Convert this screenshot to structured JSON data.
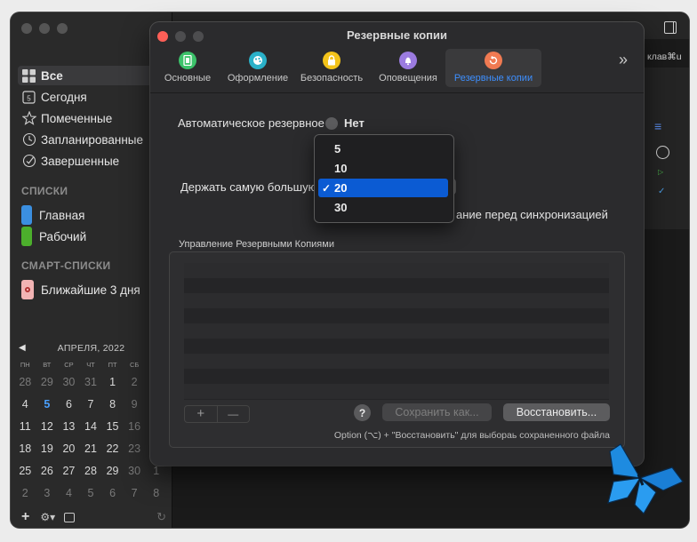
{
  "sidebar": {
    "items": [
      {
        "label": "Все",
        "icon": "grid-icon"
      },
      {
        "label": "Сегодня",
        "icon": "calendar-day-icon",
        "badge": "5"
      },
      {
        "label": "Помеченные",
        "icon": "star-icon"
      },
      {
        "label": "Запланированные",
        "icon": "clock-icon"
      },
      {
        "label": "Завершенные",
        "icon": "check-circle-icon"
      }
    ],
    "lists_header": "СПИСКИ",
    "lists": [
      {
        "label": "Главная",
        "color": "#3b8fe0"
      },
      {
        "label": "Рабочий",
        "color": "#4caf2c"
      }
    ],
    "smart_header": "СМАРТ-СПИСКИ",
    "smart_lists": [
      {
        "label": "Ближайшие 3 дня",
        "color": "#f2b4b4"
      }
    ]
  },
  "calendar": {
    "month_label": "АПРЕЛЯ, 2022",
    "dow": [
      "ПН",
      "ВТ",
      "СР",
      "ЧТ",
      "ПТ",
      "СБ",
      "ВС"
    ],
    "weeks": [
      [
        "28",
        "29",
        "30",
        "31",
        "1",
        "2",
        "3"
      ],
      [
        "4",
        "5",
        "6",
        "7",
        "8",
        "9",
        "10"
      ],
      [
        "11",
        "12",
        "13",
        "14",
        "15",
        "16",
        "17"
      ],
      [
        "18",
        "19",
        "20",
        "21",
        "22",
        "23",
        "24"
      ],
      [
        "25",
        "26",
        "27",
        "28",
        "29",
        "30",
        "1"
      ],
      [
        "2",
        "3",
        "4",
        "5",
        "6",
        "7",
        "8"
      ]
    ],
    "today": "5"
  },
  "right_pane": {
    "search_hint": "клав⌘u"
  },
  "dialog": {
    "title": "Резервные копии",
    "tabs": [
      {
        "label": "Основные",
        "color": "#3cc26a"
      },
      {
        "label": "Оформление",
        "color": "#2ab1c9"
      },
      {
        "label": "Безопасность",
        "color": "#f3c31a"
      },
      {
        "label": "Оповещения",
        "color": "#9b7be0"
      },
      {
        "label": "Резервные копии",
        "color": "#f07a52"
      }
    ],
    "more": "»",
    "auto_backup_label": "Автоматическое резервное",
    "auto_backup_value": "Нет",
    "keep_label": "Держать самую большую",
    "sync_label": "ание перед синхронизацией",
    "manage_label": "Управление Резервными Копиями",
    "add_btn": "+",
    "remove_btn": "—",
    "help_btn": "?",
    "save_btn": "Сохранить как...",
    "restore_btn": "Восстановить...",
    "hint": "Option (⌥) + \"Восстановить\" для выбораь сохраненного файла"
  },
  "dropdown": {
    "options": [
      "5",
      "10",
      "20",
      "30"
    ],
    "selected": "20"
  }
}
